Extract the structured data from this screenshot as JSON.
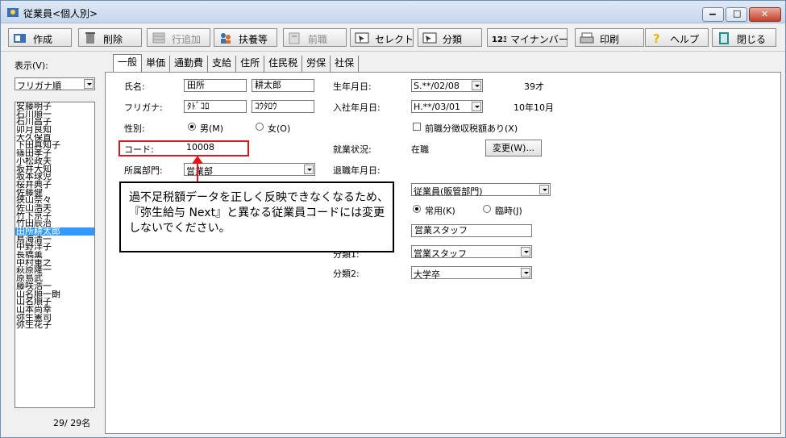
{
  "window": {
    "title": "従業員<個人別>",
    "controls": {
      "minimize": "▁",
      "maximize": "□",
      "close": "✕"
    }
  },
  "toolbar": {
    "buttons": [
      {
        "label": "作成",
        "icon": "create-icon",
        "enabled": true
      },
      {
        "label": "削除",
        "icon": "trash-icon",
        "enabled": true
      },
      {
        "label": "行追加",
        "icon": "add-row-icon",
        "enabled": false
      },
      {
        "label": "扶養等",
        "icon": "dependents-icon",
        "enabled": true
      },
      {
        "label": "前職",
        "icon": "previous-job-icon",
        "enabled": false
      },
      {
        "label": "セレクト",
        "icon": "select-icon",
        "enabled": true
      },
      {
        "label": "分類",
        "icon": "classify-icon",
        "enabled": true
      },
      {
        "label": "マイナンバー",
        "icon": "my-number-icon",
        "icon_text": "123",
        "enabled": true
      },
      {
        "label": "印刷",
        "icon": "printer-icon",
        "enabled": true
      },
      {
        "label": "ヘルプ",
        "icon": "help-icon",
        "enabled": true
      },
      {
        "label": "閉じる",
        "icon": "close-book-icon",
        "enabled": true
      }
    ]
  },
  "sidebar": {
    "display_label": "表示(V):",
    "sort_value": "フリガナ順",
    "employees": [
      "安藤明子",
      "石川順一",
      "石川昌子",
      "卯月良知",
      "大久保直",
      "下田真知子",
      "篠田孝子",
      "小松政夫",
      "坂井大知",
      "坂本球児",
      "桜井典子",
      "佐藤健",
      "狭山奈々",
      "佐山浩夫",
      "竹下京子",
      "竹田辰治",
      "田所耕太郎",
      "鳥海清一",
      "中野洋子",
      "長橋薫",
      "中村重之",
      "萩原隆一",
      "原島武",
      "藤咲浩一",
      "山名順一朗",
      "山名順子",
      "山本尚幸",
      "弥生憲司",
      "弥生花子"
    ],
    "selected_index": 16,
    "count": "29/ 29名"
  },
  "tabs": [
    "一般",
    "単価",
    "通勤費",
    "支給",
    "住所",
    "住民税",
    "労保",
    "社保"
  ],
  "active_tab": 0,
  "form": {
    "name_label": "氏名:",
    "last_name": "田所",
    "first_name": "耕太郎",
    "furigana_label": "フリガナ:",
    "last_kana": "ﾀﾄﾞｺﾛ",
    "first_kana": "ｺｳﾀﾛｳ",
    "gender_label": "性別:",
    "gender_male": "男(M)",
    "gender_female": "女(O)",
    "gender_selected": "male",
    "code_label": "コード:",
    "code": "10008",
    "dept_label": "所属部門:",
    "dept": "営業部",
    "birth_label": "生年月日:",
    "birth": "S.**/02/08",
    "age": "39才",
    "hire_label": "入社年月日:",
    "hire": "H.**/03/01",
    "tenure": "10年10月",
    "prev_tax_check": "前職分徴収税額あり(X)",
    "prev_tax_checked": false,
    "status_label": "就業状況:",
    "status": "在職",
    "change_button": "変更(W)...",
    "retire_label": "退職年月日:",
    "employee_type": "従業員(販管部門)",
    "regular": "常用(K)",
    "temporary": "臨時(J)",
    "employment_selected": "regular",
    "job_title": "営業スタッフ",
    "class1_label": "分類1:",
    "class1": "営業スタッフ",
    "class2_label": "分類2:",
    "class2": "大学卒"
  },
  "callout": {
    "lines": [
      "過不足税額データを正しく反映できなくなるため、",
      "『弥生給与 Next』と異なる従業員コードには変更",
      "しないでください。"
    ]
  },
  "colors": {
    "highlight": "#e8131a",
    "selected_row": "#3399ff"
  }
}
